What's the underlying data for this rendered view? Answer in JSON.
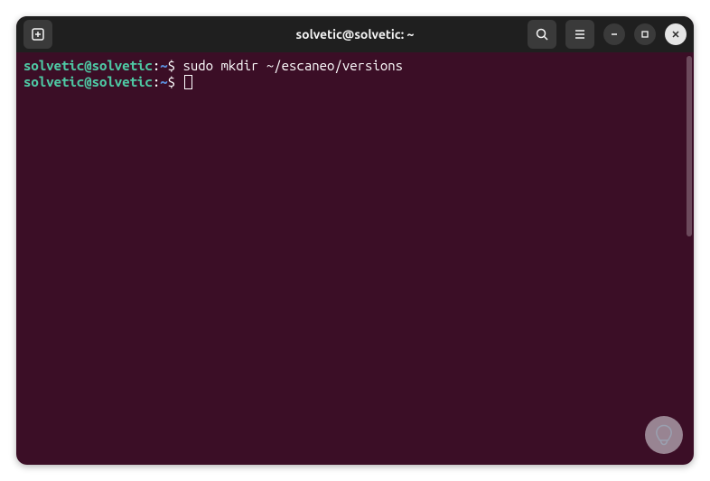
{
  "titlebar": {
    "title": "solvetic@solvetic: ~"
  },
  "icons": {
    "new_tab": "new-tab",
    "search": "search",
    "menu": "menu",
    "minimize": "minimize",
    "maximize": "maximize",
    "close": "close"
  },
  "terminal": {
    "lines": [
      {
        "prompt_user": "solvetic@solvetic",
        "prompt_sep1": ":",
        "prompt_path": "~",
        "prompt_sep2": "$ ",
        "command": "sudo mkdir ~/escaneo/versions"
      },
      {
        "prompt_user": "solvetic@solvetic",
        "prompt_sep1": ":",
        "prompt_path": "~",
        "prompt_sep2": "$ ",
        "command": ""
      }
    ]
  },
  "colors": {
    "window_bg": "#3b0e26",
    "titlebar_bg": "#1f1f1f",
    "prompt_user": "#4ec9a4",
    "prompt_path": "#5a8bd6",
    "text": "#ffffff"
  }
}
